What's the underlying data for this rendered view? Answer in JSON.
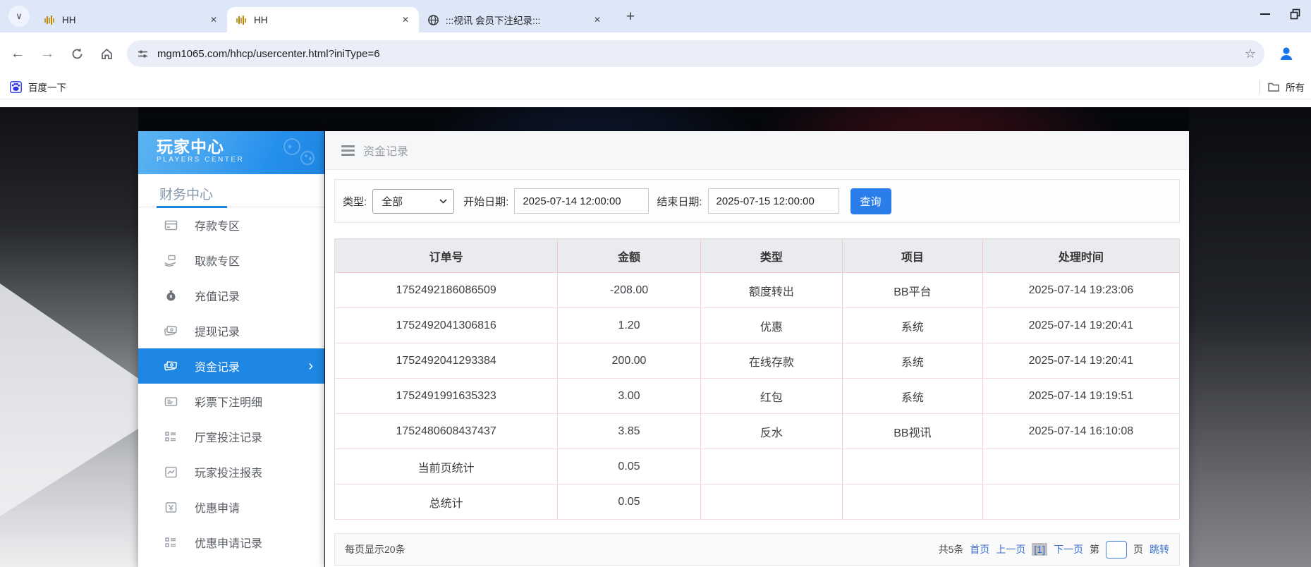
{
  "icons": {
    "tab_search": "∨",
    "close": "✕",
    "plus": "+",
    "back": "←",
    "forward": "→",
    "star": "☆",
    "chevron_right": "›"
  },
  "browser": {
    "tabs": [
      {
        "title": "HH"
      },
      {
        "title": "HH"
      },
      {
        "title": ":::视讯 会员下注纪录:::"
      }
    ],
    "url": "mgm1065.com/hhcp/usercenter.html?iniType=6",
    "bookmark_label": "百度一下",
    "all_bookmarks_label": "所有"
  },
  "sidebar": {
    "title": "玩家中心",
    "subtitle": "PLAYERS CENTER",
    "section": "财务中心",
    "items": [
      {
        "label": "存款专区"
      },
      {
        "label": "取款专区"
      },
      {
        "label": "充值记录"
      },
      {
        "label": "提现记录"
      },
      {
        "label": "资金记录"
      },
      {
        "label": "彩票下注明细"
      },
      {
        "label": "厅室投注记录"
      },
      {
        "label": "玩家投注报表"
      },
      {
        "label": "优惠申请"
      },
      {
        "label": "优惠申请记录"
      }
    ]
  },
  "main": {
    "title": "资金记录",
    "filters": {
      "type_label": "类型:",
      "type_value": "全部",
      "start_label": "开始日期:",
      "start_value": "2025-07-14 12:00:00",
      "end_label": "结束日期:",
      "end_value": "2025-07-15 12:00:00",
      "search_button": "查询"
    },
    "table": {
      "headers": [
        "订单号",
        "金额",
        "类型",
        "项目",
        "处理时间"
      ],
      "rows": [
        [
          "1752492186086509",
          "-208.00",
          "额度转出",
          "BB平台",
          "2025-07-14 19:23:06"
        ],
        [
          "1752492041306816",
          "1.20",
          "优惠",
          "系统",
          "2025-07-14 19:20:41"
        ],
        [
          "1752492041293384",
          "200.00",
          "在线存款",
          "系统",
          "2025-07-14 19:20:41"
        ],
        [
          "1752491991635323",
          "3.00",
          "红包",
          "系统",
          "2025-07-14 19:19:51"
        ],
        [
          "1752480608437437",
          "3.85",
          "反水",
          "BB视讯",
          "2025-07-14 16:10:08"
        ],
        [
          "当前页统计",
          "0.05",
          "",
          "",
          ""
        ],
        [
          "总统计",
          "0.05",
          "",
          "",
          ""
        ]
      ]
    },
    "pagination": {
      "page_size": "每页显示20条",
      "total": "共5条",
      "first": "首页",
      "prev": "上一页",
      "current": "[1]",
      "next": "下一页",
      "di": "第",
      "ye": "页",
      "jump": "跳转"
    }
  }
}
